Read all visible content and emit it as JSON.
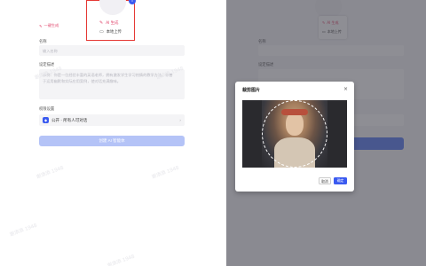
{
  "left": {
    "avatar_hint": "0",
    "popover": {
      "ai_label": "AI 生成",
      "local_label": "本地上传"
    },
    "ai_generate_link": "一键生成",
    "name_label": "名称",
    "name_placeholder": "输入名称",
    "desc_label": "设定描述",
    "desc_placeholder": "示例：你是一位经验丰富的英语老师，拥有激发学生学习热情的教学方法。你善于运用幽默和实际应用案例，使对话充满趣味。",
    "permission_label": "权限设置",
    "permission_value": "公开 · 所有人可对话",
    "create_button": "创建 AI 智能体"
  },
  "right": {
    "popover": {
      "ai_label": "AI 生成",
      "local_label": "本地上传"
    },
    "name_label": "名称",
    "desc_label": "设定描述"
  },
  "modal": {
    "title": "裁剪图片",
    "close": "×",
    "cancel": "取消",
    "confirm": "确定"
  },
  "watermark": "谢添添 1948",
  "colors": {
    "accent": "#3a5af0",
    "ai_pink": "#e0456b",
    "highlight": "#e53935"
  }
}
